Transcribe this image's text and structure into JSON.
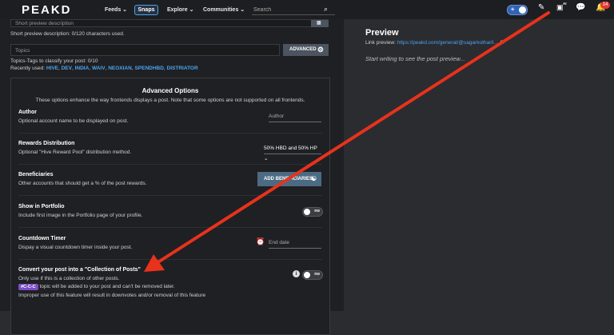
{
  "header": {
    "logo": "PEAKD",
    "nav": [
      {
        "label": "Feeds ⌄"
      },
      {
        "label": "Snaps"
      },
      {
        "label": "Explore ⌄"
      },
      {
        "label": "Communities ⌄"
      }
    ],
    "search_placeholder": "Search",
    "ai_badge": "AI",
    "notif_count": "14"
  },
  "editor": {
    "short_preview_placeholder": "Short preview description",
    "short_preview_count": "Short preview description: 0/120 characters used.",
    "topics_placeholder": "Topics",
    "advanced_label": "ADVANCED",
    "topics_help": "Topics-Tags to classify your post: 0/10",
    "recently_used_label": "Recently used:",
    "recent_tags": [
      "HIVE",
      "DEV",
      "INDIA",
      "WAIV",
      "NEOXIAN",
      "SPENDHBD",
      "DISTRIATOR"
    ]
  },
  "advanced": {
    "title": "Advanced Options",
    "subtitle": "These options enhance the way frontends displays a post. Note that some options are not supported on all frontends.",
    "author": {
      "title": "Author",
      "desc": "Optional account name to be displayed on post.",
      "placeholder": "Author"
    },
    "rewards": {
      "title": "Rewards Distribution",
      "desc": "Optional \"Hive Reward Pool\" distribution method.",
      "value": "50% HBD and 50% HP ⌄"
    },
    "beneficiaries": {
      "title": "Beneficiaries",
      "desc": "Other accounts that should get a % of the post rewards.",
      "button": "ADD BENEFICIARIES"
    },
    "portfolio": {
      "title": "Show in Portfolio",
      "desc": "Include first image in the Portfolio page of your profile.",
      "toggle": "no"
    },
    "countdown": {
      "title": "Countdown Timer",
      "desc": "Dispay a visual countdown timer inside your post.",
      "placeholder": "End date"
    },
    "collection": {
      "title": "Convert your post into a \"Collection of Posts\"",
      "desc1": "Only use if this is a collection of other posts.",
      "chip": "#C-C-C",
      "desc2": "topic will be added to your post and can't be removed later.",
      "desc3": "Improper use of this feature will result in downvotes and/or removal of this feature",
      "toggle": "no"
    }
  },
  "preview": {
    "title": "Preview",
    "link_label": "Link preview:",
    "link_url": "https://peakd.com/general/@sagarkotharil…",
    "empty": "Start writing to see the post preview..."
  },
  "colors": {
    "accent": "#4aa3f0",
    "annotation_arrow": "#e8321c",
    "chip": "#7d4cc7",
    "badge": "#e53935"
  }
}
